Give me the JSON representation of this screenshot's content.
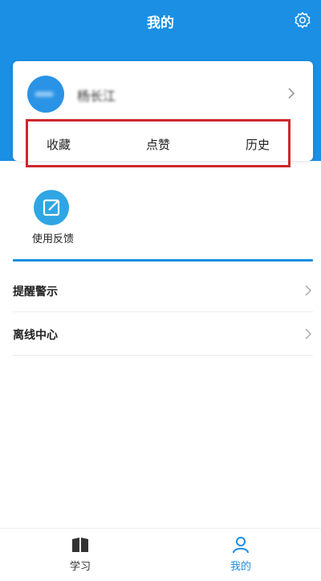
{
  "header": {
    "title": "我的",
    "settings_icon": "gear-icon"
  },
  "profile": {
    "username": "杨长江",
    "chevron_icon": "chevron-right-icon"
  },
  "quick_actions": [
    {
      "label": "收藏"
    },
    {
      "label": "点赞"
    },
    {
      "label": "历史"
    }
  ],
  "feedback": {
    "label": "使用反馈",
    "icon": "edit-icon"
  },
  "menu": [
    {
      "label": "提醒警示"
    },
    {
      "label": "离线中心"
    }
  ],
  "tabs": [
    {
      "label": "学习",
      "icon": "book-icon",
      "active": false
    },
    {
      "label": "我的",
      "icon": "user-icon",
      "active": true
    }
  ],
  "colors": {
    "brand": "#1a8fe3",
    "highlight": "#d0262b",
    "feedback_icon": "#2fa6e3",
    "tab_inactive": "#333333"
  }
}
